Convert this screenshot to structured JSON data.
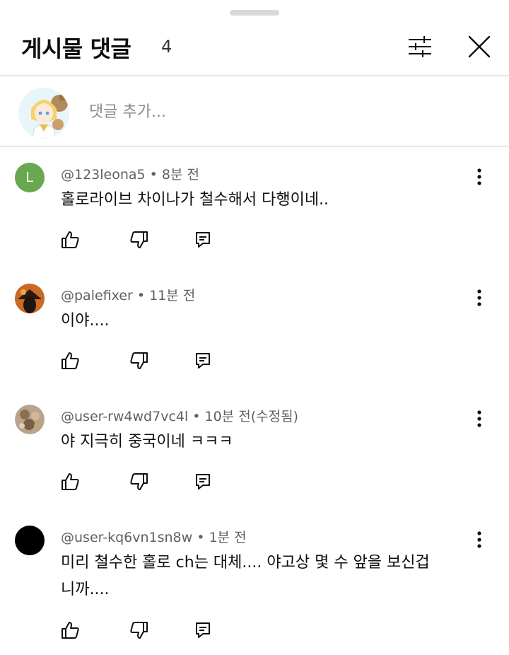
{
  "header": {
    "title": "게시물 댓글",
    "count": "4"
  },
  "add_comment": {
    "placeholder": "댓글 추가..."
  },
  "icons": {
    "filter": "filter-sliders-icon",
    "close": "close-icon",
    "more": "more-vertical-icon",
    "like": "thumbs-up-icon",
    "dislike": "thumbs-down-icon",
    "reply": "reply-comment-icon"
  },
  "colors": {
    "avatar_letter_bg": "#6aa84f",
    "meta_text": "#606060",
    "divider": "#e6e6e6"
  },
  "comments": [
    {
      "avatar_letter": "L",
      "meta": "@123leona5 • 8분 전",
      "text": "홀로라이브 차이나가 철수해서  다행이네.."
    },
    {
      "avatar_letter": "",
      "meta": "@palefixer • 11분 전",
      "text": "이야...."
    },
    {
      "avatar_letter": "",
      "meta": "@user-rw4wd7vc4l • 10분 전(수정됨)",
      "text": "야 지극히 중국이네 ㅋㅋㅋ"
    },
    {
      "avatar_letter": "",
      "meta": "@user-kq6vn1sn8w • 1분 전",
      "text": "미리 철수한 홀로 ch는 대체.... 야고상 몇 수 앞을 보신겁니까...."
    }
  ]
}
